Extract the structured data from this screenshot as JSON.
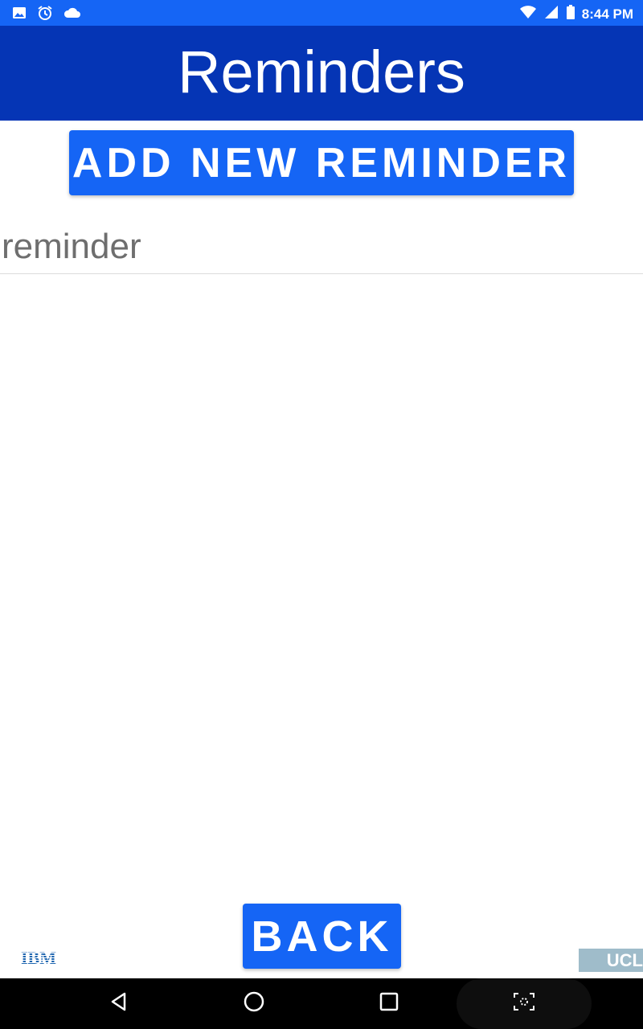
{
  "status_bar": {
    "time": "8:44 PM",
    "left_icons": [
      "image-icon",
      "alarm-icon",
      "cloud-icon"
    ],
    "right_icons": [
      "wifi-icon",
      "signal-icon",
      "battery-icon"
    ],
    "background": "#1565f5"
  },
  "app_bar": {
    "title": "Reminders",
    "background": "#0535b5"
  },
  "actions": {
    "add_label": "ADD NEW REMINDER",
    "back_label": "BACK",
    "button_color": "#1565f5"
  },
  "reminders": [
    {
      "text": "reminder"
    }
  ],
  "logos": {
    "left": "IBM",
    "right": "UCL",
    "right_background": "#9fbcca"
  },
  "nav_bar": {
    "buttons": [
      "back-icon",
      "home-icon",
      "recents-icon",
      "screenshot-icon"
    ]
  }
}
